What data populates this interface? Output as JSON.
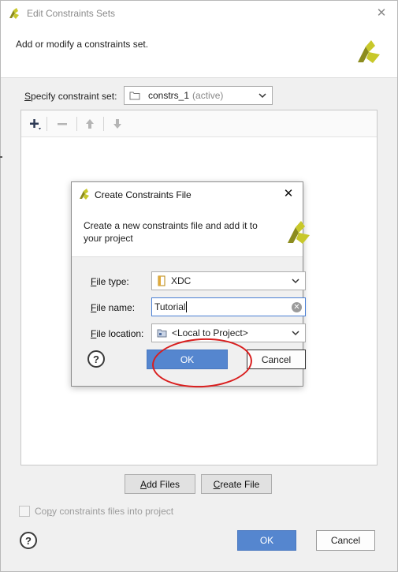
{
  "outer": {
    "title": "Edit Constraints Sets",
    "description": "Add or modify a constraints set.",
    "specify_label_first": "S",
    "specify_label_rest": "pecify constraint set:",
    "constraint_set_value": "constrs_1",
    "constraint_set_suffix": "(active)",
    "add_files_first": "A",
    "add_files_rest": "dd Files",
    "create_file_first": "C",
    "create_file_rest": "reate File",
    "copy_label_pre": "Co",
    "copy_label_u": "p",
    "copy_label_rest": "y constraints files into project",
    "ok_label": "OK",
    "cancel_label": "Cancel",
    "help_label": "?"
  },
  "dialog": {
    "title": "Create Constraints File",
    "description": "Create a new constraints file and add it to your project",
    "file_type_label_first": "F",
    "file_type_label_rest": "ile type:",
    "file_type_value": "XDC",
    "file_name_label_first": "F",
    "file_name_label_rest": "ile name:",
    "file_name_value": "Tutorial",
    "file_location_label_first": "F",
    "file_location_label_rest": "ile location:",
    "file_location_value": "<Local to Project>",
    "ok_label": "OK",
    "cancel_label": "Cancel",
    "help_label": "?"
  },
  "colors": {
    "primary_button": "#5586cf",
    "logo_yellow": "#c8c82a",
    "logo_olive": "#8c8c1e",
    "annotation_red": "#d91e1e"
  },
  "icons": [
    "vivado-app-icon",
    "close-icon",
    "vivado-logo-icon",
    "folder-icon",
    "chevron-down-icon",
    "add-icon",
    "remove-icon",
    "move-up-icon",
    "move-down-icon",
    "xdc-file-icon",
    "clear-icon",
    "help-icon"
  ]
}
